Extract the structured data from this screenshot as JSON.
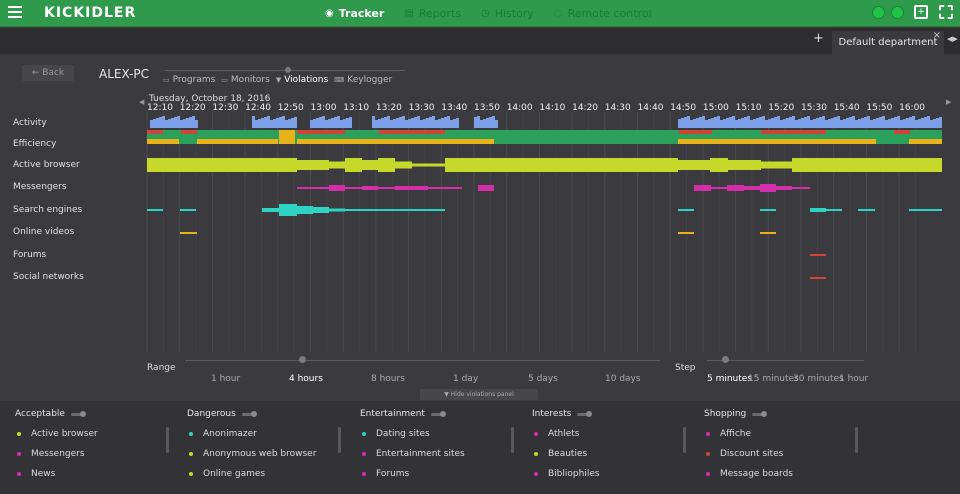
{
  "app": {
    "logo": "KICKIDLER",
    "nav": [
      {
        "label": "Tracker",
        "icon": "eye-icon",
        "active": true
      },
      {
        "label": "Reports",
        "icon": "report-icon",
        "active": false
      },
      {
        "label": "History",
        "icon": "history-icon",
        "active": false
      },
      {
        "label": "Remote control",
        "icon": "remote-icon",
        "active": false
      }
    ],
    "accent": "#2f9a4b"
  },
  "tabs": {
    "add": "+",
    "department": "Default department",
    "close": "×"
  },
  "header": {
    "back": "Back",
    "pc_name": "ALEX-PC",
    "modes": [
      {
        "label": "Programs",
        "active": false
      },
      {
        "label": "Monitors",
        "active": false
      },
      {
        "label": "Violations",
        "active": true
      },
      {
        "label": "Keylogger",
        "active": false
      }
    ]
  },
  "timeline": {
    "date": "Tuesday, October 18, 2016",
    "times": [
      "12:10",
      "12:20",
      "12:30",
      "12:40",
      "12:50",
      "13:00",
      "13:10",
      "13:20",
      "13:30",
      "13:40",
      "13:50",
      "14:00",
      "14:10",
      "14:20",
      "14:30",
      "14:40",
      "14:50",
      "15:00",
      "15:10",
      "15:20",
      "15:30",
      "15:40",
      "15:50",
      "16:00"
    ],
    "rows": [
      "Activity",
      "Efficiency",
      "Active browser",
      "Messengers",
      "Search engines",
      "Online videos",
      "Forums",
      "Social networks"
    ],
    "colors": {
      "activity": "#7ba0e8",
      "eff_green": "#2aa05a",
      "eff_red": "#d0453a",
      "eff_yellow": "#e8b21a",
      "browser": "#c6d92a",
      "messenger": "#d42ea8",
      "search": "#2fd3c4",
      "video": "#e8b21a",
      "forum": "#d0453a"
    }
  },
  "range": {
    "label": "Range",
    "options": [
      {
        "label": "1 hour",
        "active": false
      },
      {
        "label": "4 hours",
        "active": true
      },
      {
        "label": "8 hours",
        "active": false
      },
      {
        "label": "1 day",
        "active": false
      },
      {
        "label": "5 days",
        "active": false
      },
      {
        "label": "10 days",
        "active": false
      }
    ]
  },
  "step": {
    "label": "Step",
    "options": [
      {
        "label": "5 minutes",
        "active": true
      },
      {
        "label": "15 minutes",
        "active": false
      },
      {
        "label": "30 minutes",
        "active": false
      },
      {
        "label": "1 hour",
        "active": false
      }
    ]
  },
  "hide_panel": "Hide violations panel",
  "violations": [
    {
      "title": "Acceptable",
      "items": [
        {
          "label": "Active browser",
          "color": "#c6d92a"
        },
        {
          "label": "Messengers",
          "color": "#d42ea8"
        },
        {
          "label": "News",
          "color": "#d42ea8"
        }
      ]
    },
    {
      "title": "Dangerous",
      "items": [
        {
          "label": "Anonimazer",
          "color": "#2fd3c4"
        },
        {
          "label": "Anonymous web browser",
          "color": "#c6d92a"
        },
        {
          "label": "Online games",
          "color": "#c6d92a"
        }
      ]
    },
    {
      "title": "Entertainment",
      "items": [
        {
          "label": "Dating sites",
          "color": "#2fd3c4"
        },
        {
          "label": "Entertainment sites",
          "color": "#d42ea8"
        },
        {
          "label": "Forums",
          "color": "#d42ea8"
        }
      ]
    },
    {
      "title": "Interests",
      "items": [
        {
          "label": "Athlets",
          "color": "#d42ea8"
        },
        {
          "label": "Beauties",
          "color": "#c6d92a"
        },
        {
          "label": "Bibliophiles",
          "color": "#d42ea8"
        }
      ]
    },
    {
      "title": "Shopping",
      "items": [
        {
          "label": "Affiche",
          "color": "#d42ea8"
        },
        {
          "label": "Discount sites",
          "color": "#d0453a"
        },
        {
          "label": "Message boards",
          "color": "#d42ea8"
        }
      ]
    }
  ]
}
